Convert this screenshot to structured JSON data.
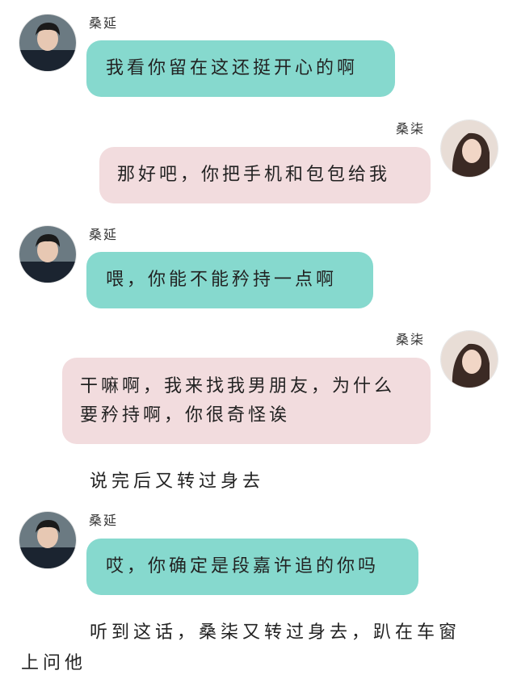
{
  "messages": [
    {
      "sender": "桑延",
      "text": "我看你留在这还挺开心的啊"
    },
    {
      "sender": "桑柒",
      "text": "那好吧，你把手机和包包给我"
    },
    {
      "sender": "桑延",
      "text": "喂，你能不能矜持一点啊"
    },
    {
      "sender": "桑柒",
      "text": "干嘛啊，我来找我男朋友，为什么要矜持啊，你很奇怪诶"
    }
  ],
  "narration_1": "说完后又转过身去",
  "message_5": {
    "sender": "桑延",
    "text": "哎，你确定是段嘉许追的你吗"
  },
  "narration_2": "听到这话，桑柒又转过身去，趴在车窗上问他",
  "colors": {
    "left_bubble": "#86d9ce",
    "right_bubble": "#f2dcde"
  },
  "icons": {
    "left_avatar": "male-avatar-icon",
    "right_avatar": "female-avatar-icon"
  }
}
